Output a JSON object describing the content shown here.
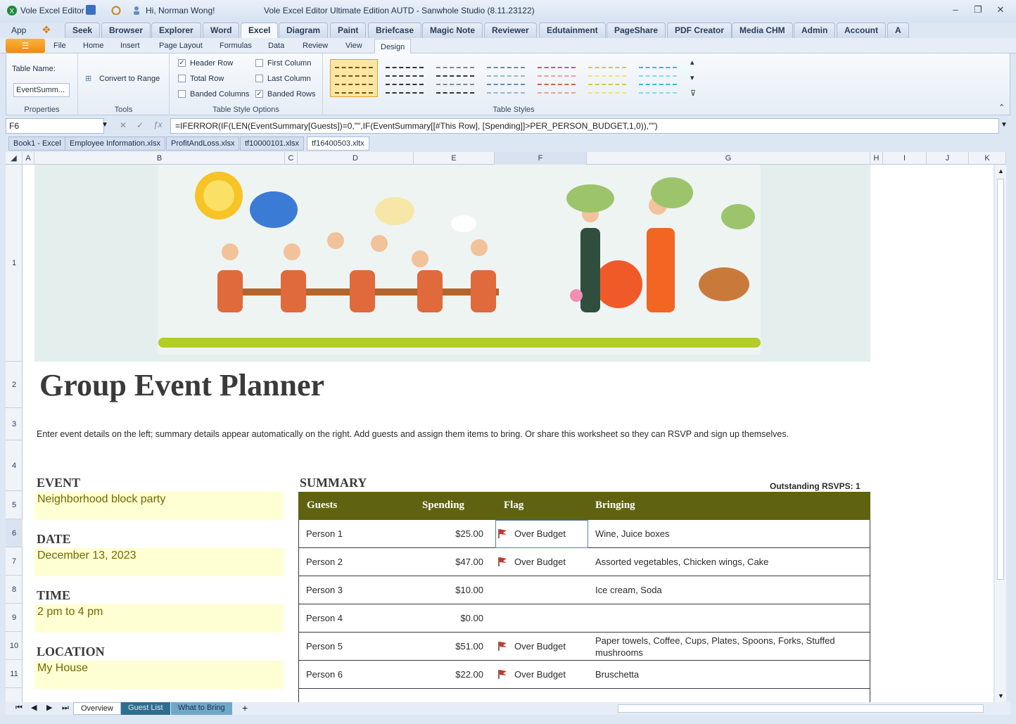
{
  "titlebar": {
    "app": "Vole Excel Editor",
    "greeting": "Hi, Norman Wong!",
    "title": "Vole Excel Editor Ultimate Edition AUTD - Sanwhole Studio (8.11.23122)"
  },
  "app_tabs": [
    "App",
    "Seek",
    "Browser",
    "Explorer",
    "Word",
    "Excel",
    "Diagram",
    "Paint",
    "Briefcase",
    "Magic Note",
    "Reviewer",
    "Edutainment",
    "PageShare",
    "PDF Creator",
    "Media CHM",
    "Admin",
    "Account",
    "A"
  ],
  "ribbon_tabs": [
    "File",
    "Home",
    "Insert",
    "Page Layout",
    "Formulas",
    "Data",
    "Review",
    "View",
    "Design"
  ],
  "ribbon": {
    "table_name_label": "Table Name:",
    "table_name_value": "EventSumm...",
    "properties": "Properties",
    "convert": "Convert to Range",
    "tools": "Tools",
    "options": {
      "header_row": "Header Row",
      "total_row": "Total Row",
      "banded_columns": "Banded Columns",
      "first_column": "First Column",
      "last_column": "Last Column",
      "banded_rows": "Banded Rows"
    },
    "options_group": "Table Style Options",
    "styles_group": "Table Styles"
  },
  "formula_bar": {
    "cell": "F6",
    "formula": "=IFERROR(IF(LEN(EventSummary[Guests])=0,\"\",IF(EventSummary[[#This Row], [Spending]]>PER_PERSON_BUDGET,1,0)),\"\")"
  },
  "workbook_tabs": [
    "Book1 - Excel",
    "Employee Information.xlsx",
    "ProfitAndLoss.xlsx",
    "tf10000101.xlsx",
    "tf16400503.xltx"
  ],
  "columns": [
    "A",
    "B",
    "C",
    "D",
    "E",
    "F",
    "G",
    "H",
    "I",
    "J",
    "K"
  ],
  "rows": [
    "1",
    "2",
    "3",
    "4",
    "5",
    "6",
    "7",
    "8",
    "9",
    "10",
    "11"
  ],
  "sheet": {
    "title": "Group Event Planner",
    "description": "Enter event details on the left; summary details appear automatically on the right. Add guests and assign them items to bring. Or share this worksheet so they can RSVP and sign up themselves.",
    "event_label": "EVENT",
    "event_value": "Neighborhood block party",
    "date_label": "DATE",
    "date_value": "December 13, 2023",
    "time_label": "TIME",
    "time_value": "2 pm to 4 pm",
    "location_label": "LOCATION",
    "location_value": "My House",
    "summary_label": "SUMMARY",
    "rsvp": "Outstanding RSVPS: 1",
    "headers": [
      "Guests",
      "Spending",
      "Flag",
      "Bringing"
    ],
    "rows": [
      {
        "guest": "Person 1",
        "spending": "$25.00",
        "flag": "Over Budget",
        "bringing": "Wine, Juice boxes"
      },
      {
        "guest": "Person 2",
        "spending": "$47.00",
        "flag": "Over Budget",
        "bringing": "Assorted vegetables, Chicken wings, Cake"
      },
      {
        "guest": "Person 3",
        "spending": "$10.00",
        "flag": "",
        "bringing": "Ice cream, Soda"
      },
      {
        "guest": "Person 4",
        "spending": "$0.00",
        "flag": "",
        "bringing": ""
      },
      {
        "guest": "Person 5",
        "spending": "$51.00",
        "flag": "Over Budget",
        "bringing": "Paper towels, Coffee, Cups, Plates, Spoons, Forks, Stuffed mushrooms"
      },
      {
        "guest": "Person 6",
        "spending": "$22.00",
        "flag": "Over Budget",
        "bringing": "Bruschetta"
      }
    ]
  },
  "sheet_tabs": [
    "Overview",
    "Guest List",
    "What to Bring"
  ],
  "colors": {
    "header": "#5f6211",
    "input_bg": "#feffd2",
    "flag": "#c0392b"
  }
}
